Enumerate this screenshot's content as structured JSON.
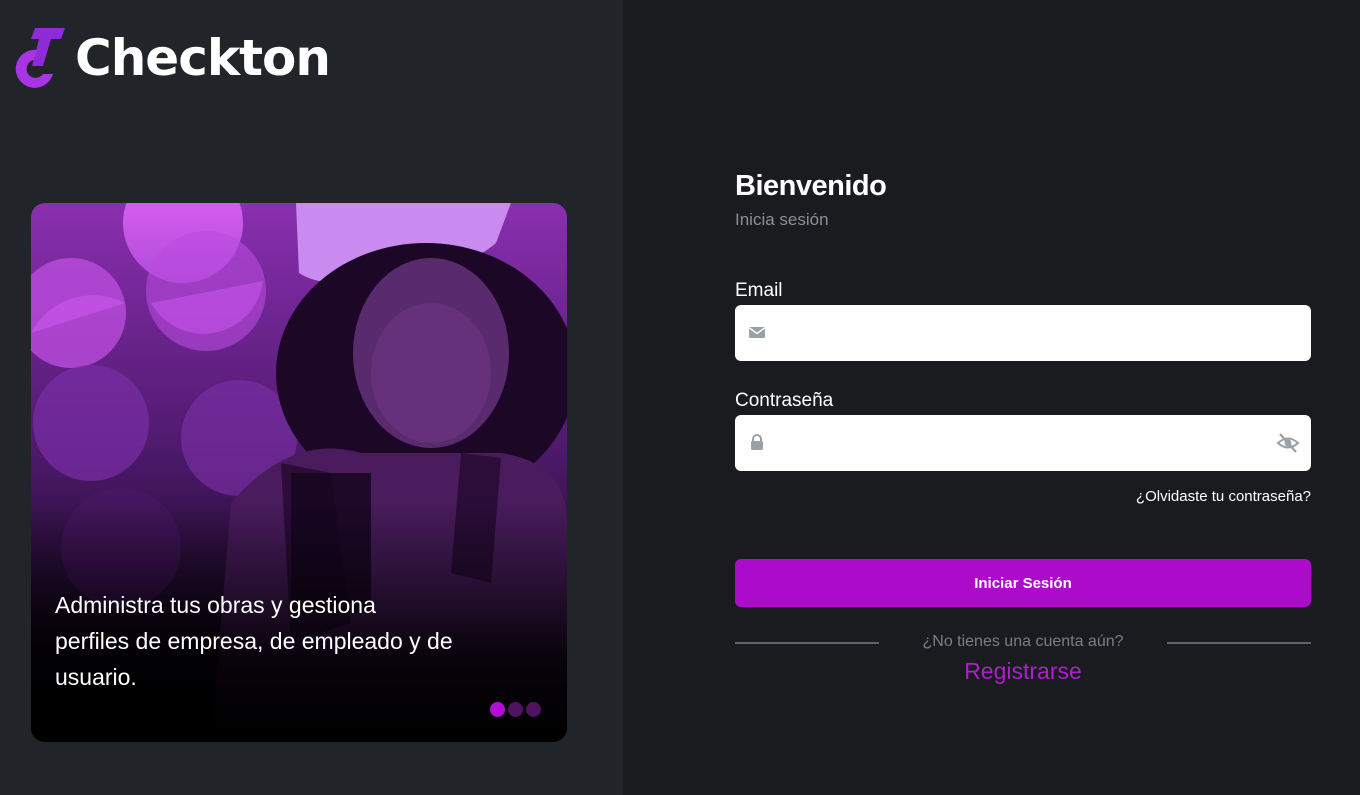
{
  "brand": {
    "name": "Checkton",
    "accent": "#ac0bcb",
    "link_color": "#b11cd0",
    "left_bg": "#212529",
    "right_bg": "#191b1f",
    "logo_icon": "checkton-logo-icon"
  },
  "hero": {
    "caption": "Administra tus obras y gestiona perfiles de empresa, de empleado y de usuario.",
    "slides_total": 3,
    "active_slide": 1
  },
  "login": {
    "title": "Bienvenido",
    "subtitle": "Inicia sesión",
    "email_label": "Email",
    "email_value": "",
    "email_icon": "envelope-icon",
    "password_label": "Contraseña",
    "password_value": "",
    "password_icon": "lock-icon",
    "toggle_icon": "eye-slash-icon",
    "forgot_label": "¿Olvidaste tu contraseña?",
    "submit_label": "Iniciar Sesión",
    "no_account_text": "¿No tienes una cuenta aún?",
    "register_label": "Registrarse"
  }
}
